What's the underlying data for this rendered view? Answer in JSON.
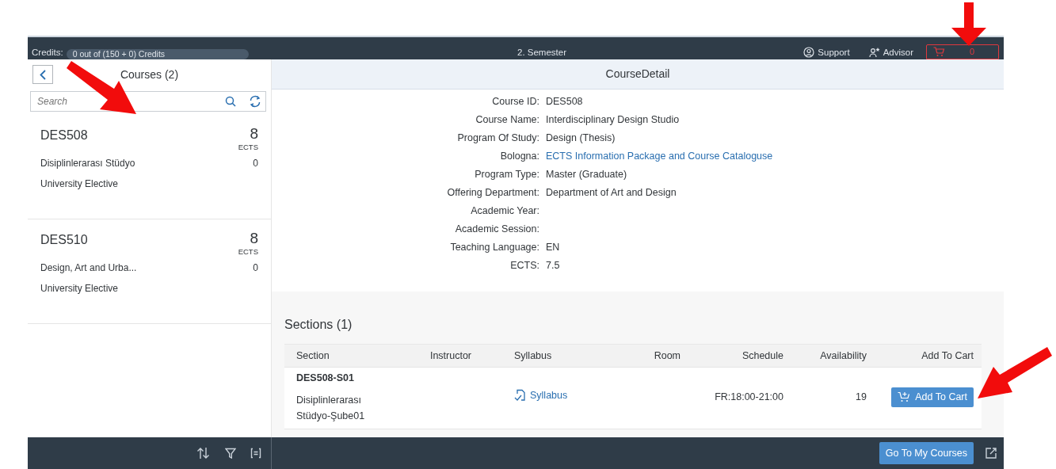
{
  "top_bar": {
    "credits_label": "Credits:",
    "credits_value": "0 out of (150 + 0) Credits",
    "semester": "2. Semester",
    "links": [
      {
        "label": "Support",
        "kind": "support"
      },
      {
        "label": "Advisor",
        "kind": "advisor"
      }
    ],
    "cart_count": "0"
  },
  "master": {
    "title": "Courses (2)",
    "search": {
      "placeholder": "Search"
    },
    "courses": [
      {
        "code": "DES508",
        "ects": "8",
        "ects_unit": "ECTS",
        "name": "Disiplinlerarası Stüdyo",
        "count": "0",
        "type": "University Elective"
      },
      {
        "code": "DES510",
        "ects": "8",
        "ects_unit": "ECTS",
        "name": "Design, Art and Urba...",
        "count": "0",
        "type": "University Elective"
      }
    ]
  },
  "detail": {
    "title": "CourseDetail",
    "fields": [
      {
        "label": "Course ID:",
        "value": "DES508",
        "kind": "text"
      },
      {
        "label": "Course Name:",
        "value": "Interdisciplinary Design Studio",
        "kind": "text"
      },
      {
        "label": "Program Of Study:",
        "value": "Design (Thesis)",
        "kind": "text"
      },
      {
        "label": "Bologna:",
        "value": "ECTS Information Package and Course Cataloguse",
        "kind": "link"
      },
      {
        "label": "Program Type:",
        "value": "Master (Graduate)",
        "kind": "text"
      },
      {
        "label": "Offering Department:",
        "value": "Department of Art and Design",
        "kind": "text"
      },
      {
        "label": "Academic Year:"
      },
      {
        "label": "Academic Session:"
      },
      {
        "label": "Teaching Language:",
        "value": "EN",
        "kind": "text"
      },
      {
        "label": "ECTS:",
        "value": "7.5",
        "kind": "text"
      }
    ],
    "sections": {
      "title": "Sections (1)",
      "columns": [
        "Section",
        "Instructor",
        "Syllabus",
        "Room",
        "Schedule",
        "Availability",
        "Add To Cart"
      ],
      "rows": [
        {
          "section": "DES508-S01",
          "description": "Disiplinlerarası Stüdyo-Şube01",
          "syllabus": "Syllabus",
          "schedule": "FR:18:00-21:00",
          "availability": "19",
          "action": "Add To Cart"
        }
      ]
    }
  },
  "footer": {
    "button": "Go To My Courses"
  }
}
